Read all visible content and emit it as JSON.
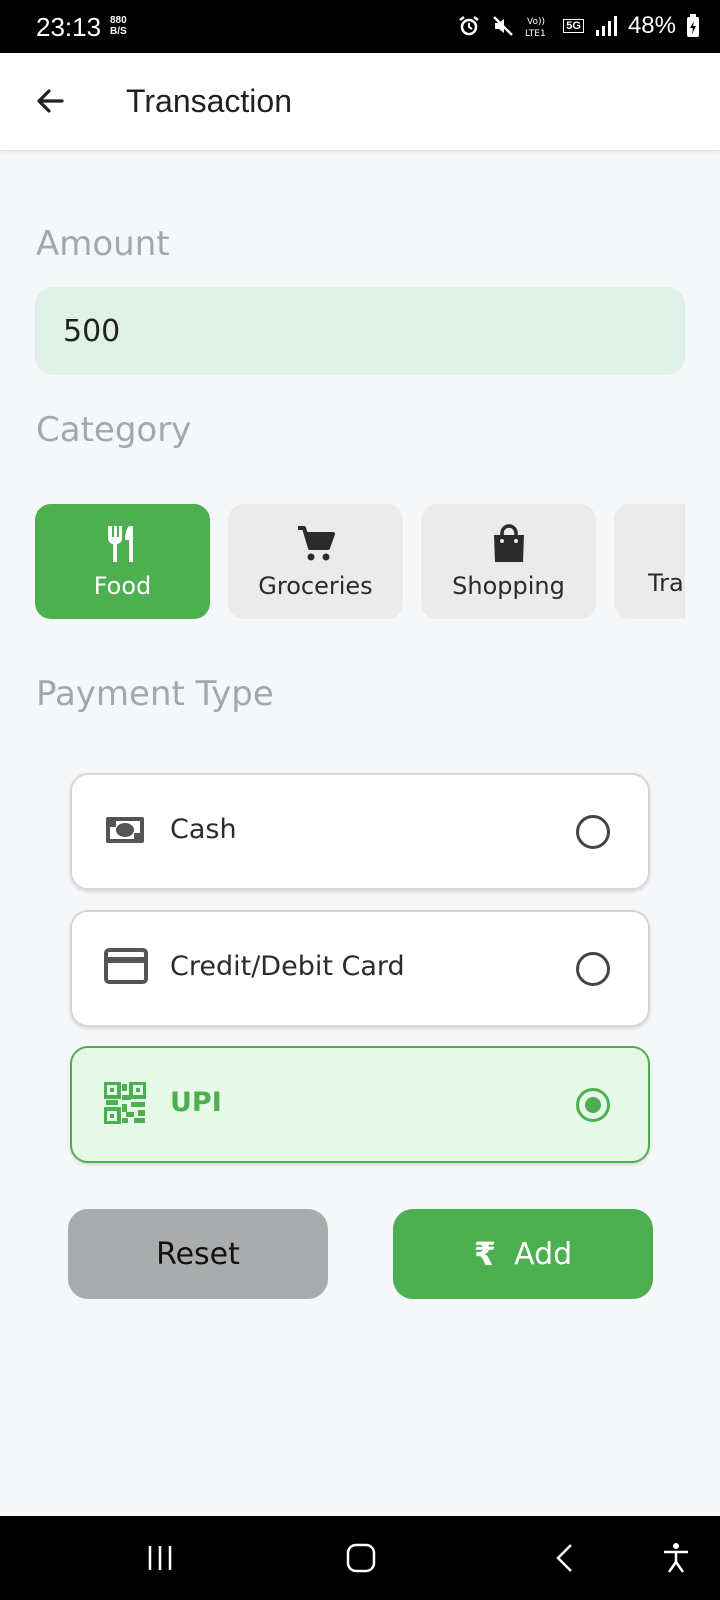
{
  "status_bar": {
    "time": "23:13",
    "speed_value": "880",
    "speed_unit": "B/S",
    "network": "5G",
    "battery": "48%"
  },
  "app_bar": {
    "title": "Transaction",
    "back_icon": "arrow-left-icon"
  },
  "amount": {
    "label": "Amount",
    "value": "500"
  },
  "category": {
    "label": "Category",
    "items": [
      {
        "label": "Food",
        "icon": "fork-knife-icon",
        "selected": true
      },
      {
        "label": "Groceries",
        "icon": "cart-icon",
        "selected": false
      },
      {
        "label": "Shopping",
        "icon": "shopping-bag-icon",
        "selected": false
      },
      {
        "label": "Tra",
        "icon": "",
        "selected": false
      }
    ]
  },
  "payment": {
    "label": "Payment Type",
    "options": [
      {
        "label": "Cash",
        "icon": "cash-icon",
        "selected": false
      },
      {
        "label": "Credit/Debit Card",
        "icon": "credit-card-icon",
        "selected": false
      },
      {
        "label": "UPI",
        "icon": "qr-code-icon",
        "selected": true
      }
    ]
  },
  "actions": {
    "reset_label": "Reset",
    "add_symbol": "₹",
    "add_label": "Add"
  },
  "colors": {
    "accent": "#4caf50",
    "amount_bg": "#e0f1e7",
    "selected_option_bg": "#e7f8e8",
    "reset_bg": "#a9abac"
  }
}
